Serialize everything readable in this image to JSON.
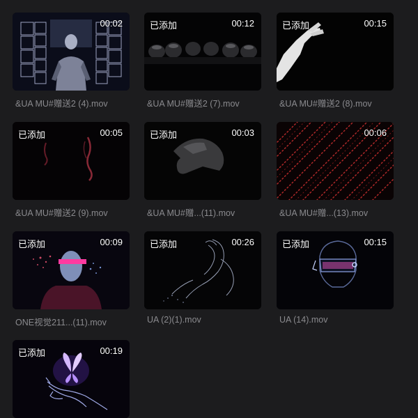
{
  "clips": [
    {
      "name": "&UA  MU#赠送2 (4).mov",
      "duration": "00:02",
      "added_label": "",
      "thumbnail_icon": "figure-in-cube-room-thumbnail"
    },
    {
      "name": "&UA  MU#赠送2 (7).mov",
      "duration": "00:12",
      "added_label": "已添加",
      "thumbnail_icon": "dark-spheres-row-thumbnail"
    },
    {
      "name": "&UA  MU#赠送2 (8).mov",
      "duration": "00:15",
      "added_label": "已添加",
      "thumbnail_icon": "reaching-hand-thumbnail"
    },
    {
      "name": "&UA  MU#赠送2 (9).mov",
      "duration": "00:05",
      "added_label": "已添加",
      "thumbnail_icon": "red-smoke-thumbnail"
    },
    {
      "name": "&UA  MU#赠...(11).mov",
      "duration": "00:03",
      "added_label": "已添加",
      "thumbnail_icon": "grey-hand-thumbnail"
    },
    {
      "name": "&UA  MU#赠...(13).mov",
      "duration": "00:06",
      "added_label": "",
      "thumbnail_icon": "red-code-rain-thumbnail"
    },
    {
      "name": "ONE视觉211...(11).mov",
      "duration": "00:09",
      "added_label": "已添加",
      "thumbnail_icon": "neon-face-thumbnail"
    },
    {
      "name": "UA  (2)(1).mov",
      "duration": "00:26",
      "added_label": "已添加",
      "thumbnail_icon": "dissolving-figure-thumbnail"
    },
    {
      "name": "UA  (14).mov",
      "duration": "00:15",
      "added_label": "已添加",
      "thumbnail_icon": "vr-headset-head-thumbnail"
    },
    {
      "name": "",
      "duration": "00:19",
      "added_label": "已添加",
      "thumbnail_icon": "glowing-butterfly-hand-thumbnail"
    }
  ]
}
